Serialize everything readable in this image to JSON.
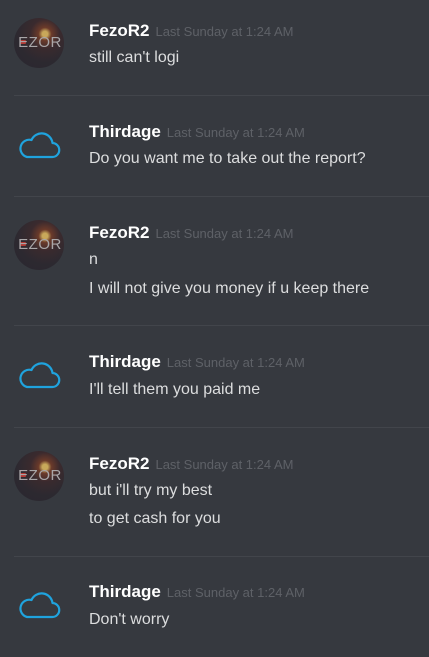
{
  "messages": [
    {
      "author": "FezoR2",
      "avatar_icon": "fezor-avatar",
      "avatar_text": "EZOR",
      "timestamp": "Last Sunday at 1:24 AM",
      "lines": [
        "still can't logi"
      ]
    },
    {
      "author": "Thirdage",
      "avatar_icon": "cloud-icon",
      "timestamp": "Last Sunday at 1:24 AM",
      "lines": [
        "Do you want me to take out the report?"
      ]
    },
    {
      "author": "FezoR2",
      "avatar_icon": "fezor-avatar",
      "avatar_text": "EZOR",
      "timestamp": "Last Sunday at 1:24 AM",
      "lines": [
        "n",
        "I will not give you money if u keep there"
      ]
    },
    {
      "author": "Thirdage",
      "avatar_icon": "cloud-icon",
      "timestamp": "Last Sunday at 1:24 AM",
      "lines": [
        "I'll tell them you paid me"
      ]
    },
    {
      "author": "FezoR2",
      "avatar_icon": "fezor-avatar",
      "avatar_text": "EZOR",
      "timestamp": "Last Sunday at 1:24 AM",
      "lines": [
        "but i'll try my best",
        "to get cash for you"
      ]
    },
    {
      "author": "Thirdage",
      "avatar_icon": "cloud-icon",
      "timestamp": "Last Sunday at 1:24 AM",
      "lines": [
        "Don't worry"
      ]
    }
  ],
  "colors": {
    "background": "#36393f",
    "divider": "#42454b",
    "author": "#ffffff",
    "message_text": "#dcddde",
    "timestamp": "#5e6167",
    "cloud_icon": "#1fa3de"
  }
}
